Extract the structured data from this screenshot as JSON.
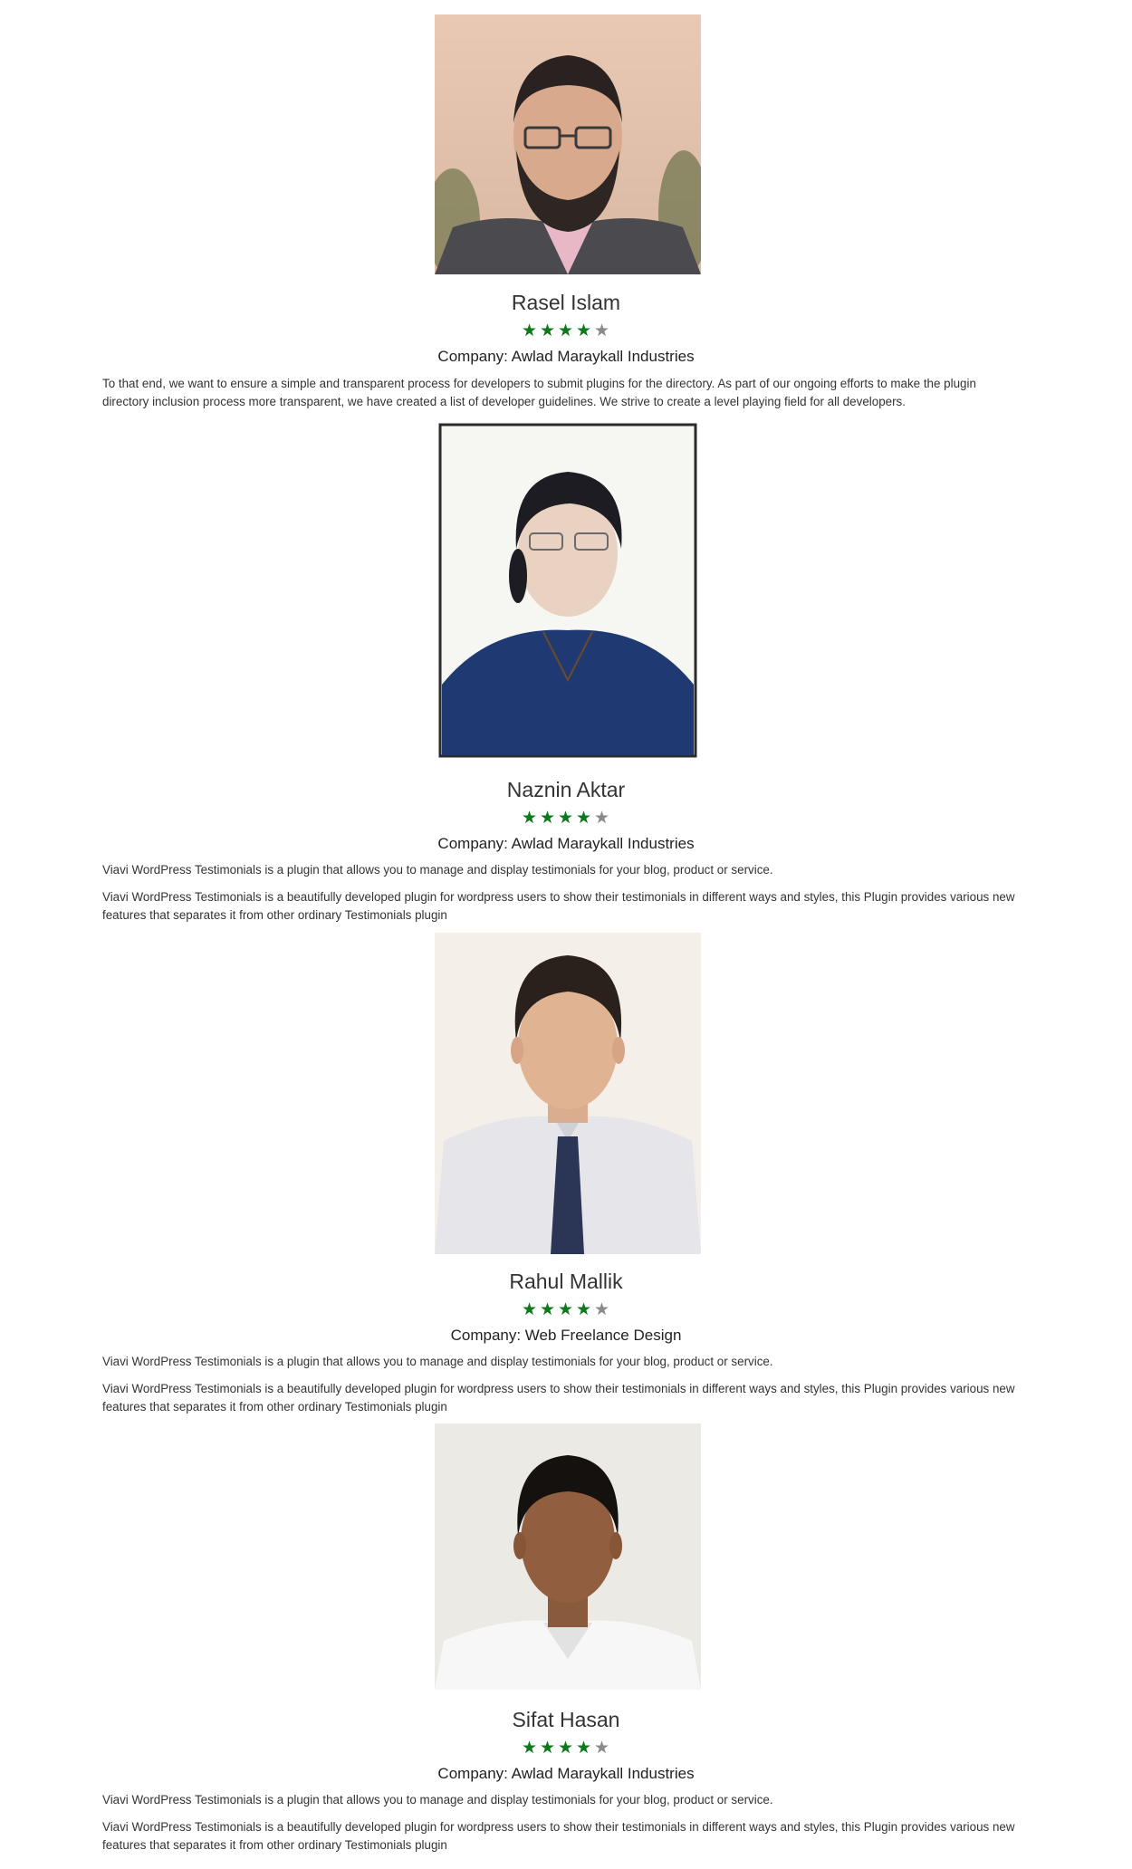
{
  "testimonials": [
    {
      "name": "Rasel Islam",
      "rating": 4,
      "rating_max": 5,
      "company": "Company: Awlad Maraykall Industries",
      "paragraphs": [
        "To that end, we want to ensure a simple and transparent process for developers to submit plugins for the directory. As part of our ongoing efforts to make the plugin directory inclusion process more transparent, we have created a list of developer guidelines. We strive to create a level playing field for all developers."
      ]
    },
    {
      "name": "Naznin Aktar",
      "rating": 4,
      "rating_max": 5,
      "company": "Company: Awlad Maraykall Industries",
      "paragraphs": [
        "Viavi WordPress Testimonials is a plugin that allows you to manage and display testimonials for your blog, product or service.",
        "Viavi WordPress Testimonials is a beautifully developed plugin for wordpress users to show their testimonials in different ways and styles, this Plugin provides various new features that separates it from other ordinary Testimonials plugin"
      ]
    },
    {
      "name": "Rahul Mallik",
      "rating": 4,
      "rating_max": 5,
      "company": "Company: Web Freelance Design",
      "paragraphs": [
        "Viavi WordPress Testimonials is a plugin that allows you to manage and display testimonials for your blog, product or service.",
        "Viavi WordPress Testimonials is a beautifully developed plugin for wordpress users to show their testimonials in different ways and styles, this Plugin provides various new features that separates it from other ordinary Testimonials plugin"
      ]
    },
    {
      "name": "Sifat Hasan",
      "rating": 4,
      "rating_max": 5,
      "company": "Company: Awlad Maraykall Industries",
      "paragraphs": [
        "Viavi WordPress Testimonials is a plugin that allows you to manage and display testimonials for your blog, product or service.",
        "Viavi WordPress Testimonials is a beautifully developed plugin for wordpress users to show their testimonials in different ways and styles, this Plugin provides various new features that separates it from other ordinary Testimonials plugin"
      ]
    }
  ],
  "colors": {
    "star_filled": "#0a7a1a",
    "star_empty": "#8a8a8a",
    "text": "#333333"
  }
}
